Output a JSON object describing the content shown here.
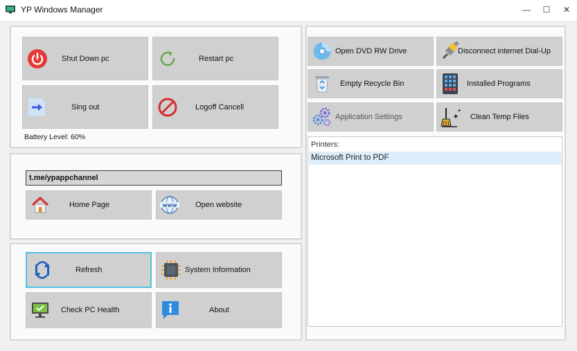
{
  "window": {
    "title": "YP Windows Manager",
    "controls": {
      "minimize": "—",
      "maximize": "☐",
      "close": "✕"
    }
  },
  "power_panel": {
    "shutdown": "Shut Down pc",
    "restart": "Restart pc",
    "signout": "Sing out",
    "logoff_cancel": "Logoff Cancell",
    "battery": "Battery Level: 60%"
  },
  "web_panel": {
    "url_value": "t.me/ypappchannel",
    "home_page": "Home Page",
    "open_website": "Open website"
  },
  "info_panel": {
    "refresh": "Refresh",
    "system_information": "System Information",
    "check_pc_health": "Check PC Health",
    "about": "About"
  },
  "tools_panel": {
    "open_dvd": "Open DVD RW Drive",
    "disconnect_internet": "Disconnect internet Dial-Up",
    "empty_recycle_bin": "Empty Recycle Bin",
    "installed_programs": "Installed Programs",
    "application_settings": "Application Settings",
    "clean_temp_files": "Clean Temp Files"
  },
  "printers": {
    "title": "Printers:",
    "items": [
      "Microsoft Print to PDF"
    ]
  },
  "icons": {
    "app": "monitor-app-icon",
    "shutdown": "power-icon",
    "restart": "refresh-circle-icon",
    "signout": "arrow-right-icon",
    "logoff_cancel": "no-entry-icon",
    "home": "house-icon",
    "website": "www-globe-icon",
    "refresh": "sync-icon",
    "system_information": "cpu-chip-icon",
    "check_pc_health": "monitor-check-icon",
    "about": "info-icon",
    "dvd": "disc-icon",
    "disconnect": "plug-icon",
    "recycle_bin": "recycle-bin-icon",
    "installed_programs": "app-grid-icon",
    "settings": "gears-icon",
    "clean_temp": "broom-icon"
  },
  "colors": {
    "button_bg": "#d0d0d0",
    "focus_border": "#4fc3e6",
    "printer_selected": "#ddeefa",
    "power_red": "#e53935",
    "restart_green": "#6aa84f",
    "disabled_text": "#555555"
  }
}
